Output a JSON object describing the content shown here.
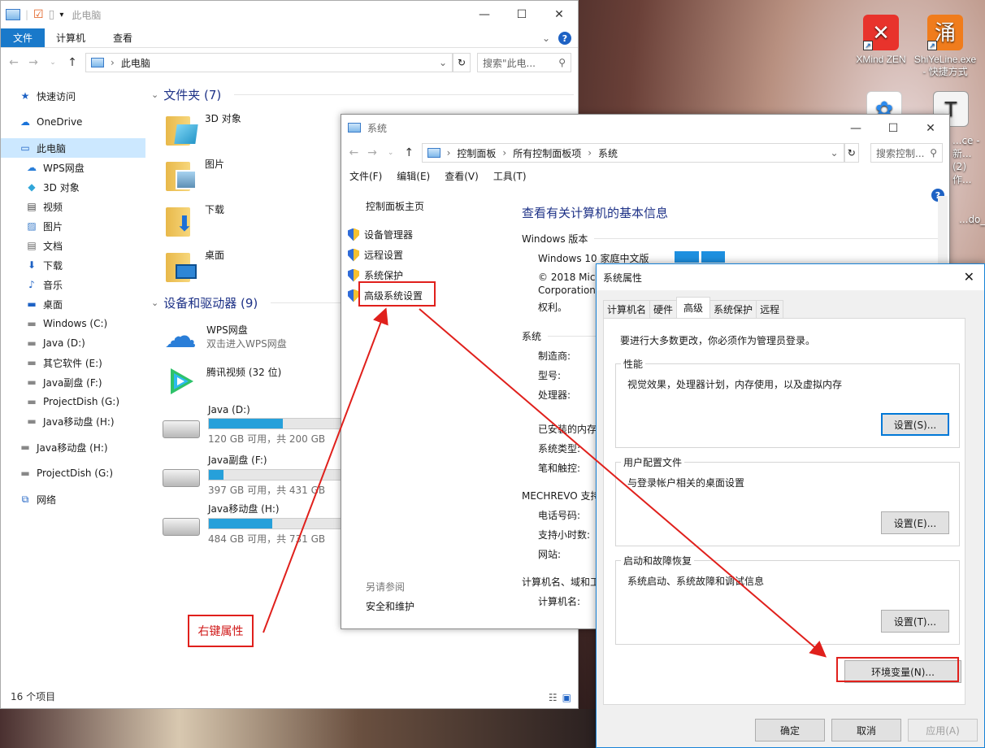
{
  "desktop": {
    "icons": [
      {
        "label": "XMind ZEN",
        "glyph": "✕",
        "color": "#e8332c"
      },
      {
        "label": "ShiYeLine.exe - 快捷方式",
        "glyph": "涌",
        "color": "#f07c1c"
      }
    ],
    "partial_texts": [
      "...ce - 新...",
      "(2) 作...",
      "...do_"
    ]
  },
  "explorer": {
    "title": "此电脑",
    "ribbon_tabs": [
      "文件",
      "计算机",
      "查看"
    ],
    "address": "此电脑",
    "search_placeholder": "搜索\"此电...",
    "nav": [
      {
        "label": "快速访问",
        "icon": "star-icon",
        "sub": false
      },
      {
        "label": "OneDrive",
        "icon": "cloud-icon",
        "sub": false
      },
      {
        "label": "此电脑",
        "icon": "computer-icon",
        "sub": false,
        "selected": true
      },
      {
        "label": "WPS网盘",
        "icon": "wps-cloud-icon",
        "sub": true
      },
      {
        "label": "3D 对象",
        "icon": "cube-icon",
        "sub": true
      },
      {
        "label": "视频",
        "icon": "video-icon",
        "sub": true
      },
      {
        "label": "图片",
        "icon": "picture-icon",
        "sub": true
      },
      {
        "label": "文档",
        "icon": "document-icon",
        "sub": true
      },
      {
        "label": "下载",
        "icon": "download-icon",
        "sub": true
      },
      {
        "label": "音乐",
        "icon": "music-icon",
        "sub": true
      },
      {
        "label": "桌面",
        "icon": "desktop-icon",
        "sub": true
      },
      {
        "label": "Windows (C:)",
        "icon": "drive-icon",
        "sub": true
      },
      {
        "label": "Java (D:)",
        "icon": "drive-icon",
        "sub": true
      },
      {
        "label": "其它软件 (E:)",
        "icon": "drive-icon",
        "sub": true
      },
      {
        "label": "Java副盘 (F:)",
        "icon": "drive-icon",
        "sub": true
      },
      {
        "label": "ProjectDish (G:)",
        "icon": "drive-icon",
        "sub": true
      },
      {
        "label": "Java移动盘 (H:)",
        "icon": "drive-icon",
        "sub": true
      },
      {
        "label": "Java移动盘 (H:)",
        "icon": "drive-icon",
        "sub": false
      },
      {
        "label": "ProjectDish (G:)",
        "icon": "drive-icon",
        "sub": false
      },
      {
        "label": "网络",
        "icon": "network-icon",
        "sub": false
      }
    ],
    "folders_header": "文件夹 (7)",
    "folders": [
      "3D 对象",
      "图片",
      "下载",
      "桌面"
    ],
    "devices_header": "设备和驱动器 (9)",
    "wps": {
      "name": "WPS网盘",
      "desc": "双击进入WPS网盘"
    },
    "tencent": {
      "name": "腾讯视频 (32 位)"
    },
    "drives": [
      {
        "name": "Java (D:)",
        "used_fraction": 0.4,
        "info": "120 GB 可用，共 200 GB"
      },
      {
        "name": "Java副盘 (F:)",
        "used_fraction": 0.08,
        "info": "397 GB 可用，共 431 GB"
      },
      {
        "name": "Java移动盘 (H:)",
        "used_fraction": 0.34,
        "info": "484 GB 可用，共 731 GB"
      }
    ],
    "status": "16 个项目"
  },
  "system": {
    "title": "系统",
    "breadcrumb": [
      "控制面板",
      "所有控制面板项",
      "系统"
    ],
    "search_placeholder": "搜索控制...",
    "menu": [
      "文件(F)",
      "编辑(E)",
      "查看(V)",
      "工具(T)"
    ],
    "left_home": "控制面板主页",
    "left_links": [
      "设备管理器",
      "远程设置",
      "系统保护",
      "高级系统设置"
    ],
    "see_also": "另请参阅",
    "see_also_link": "安全和维护",
    "heading": "查看有关计算机的基本信息",
    "win_edition_label": "Windows 版本",
    "win_edition": "Windows 10 家庭中文版",
    "copyright_1": "© 2018 Mic",
    "copyright_2": "Corporation",
    "copyright_3": "权利。",
    "system_label": "系统",
    "sys_rows": [
      "制造商:",
      "型号:",
      "处理器:"
    ],
    "sys_rows2": [
      "已安装的内存",
      "系统类型:",
      "笔和触控:"
    ],
    "support_label": "MECHREVO 支持",
    "support_rows": [
      "电话号码:",
      "支持小时数:",
      "网站:"
    ],
    "computer_label": "计算机名、域和工",
    "computer_rows": [
      "计算机名:"
    ]
  },
  "props": {
    "title": "系统属性",
    "tabs": [
      "计算机名",
      "硬件",
      "高级",
      "系统保护",
      "远程"
    ],
    "admin_note": "要进行大多数更改，你必须作为管理员登录。",
    "perf_label": "性能",
    "perf_desc": "视觉效果，处理器计划，内存使用，以及虚拟内存",
    "perf_btn": "设置(S)...",
    "profile_label": "用户配置文件",
    "profile_desc": "与登录帐户相关的桌面设置",
    "profile_btn": "设置(E)...",
    "startup_label": "启动和故障恢复",
    "startup_desc": "系统启动、系统故障和调试信息",
    "startup_btn": "设置(T)...",
    "env_btn": "环境变量(N)...",
    "ok": "确定",
    "cancel": "取消",
    "apply": "应用(A)"
  },
  "annotation": {
    "note": "右键属性",
    "color": "#e0201c"
  }
}
